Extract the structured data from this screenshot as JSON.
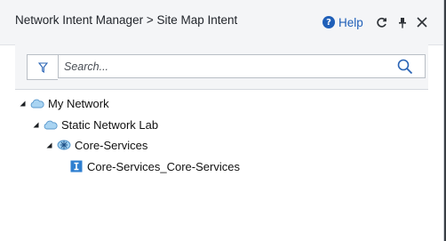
{
  "header": {
    "title": "Network Intent Manager  > Site Map Intent",
    "help_label": "Help",
    "help_icon": "question-circle-icon",
    "refresh_icon": "refresh-icon",
    "pin_icon": "pin-icon",
    "close_icon": "close-icon"
  },
  "search": {
    "placeholder": "Search...",
    "value": "",
    "filter_icon": "filter-icon",
    "search_icon": "magnifier-icon"
  },
  "tree": {
    "nodes": [
      {
        "label": "My Network",
        "icon": "cloud-icon",
        "expanded": true
      },
      {
        "label": "Static Network Lab",
        "icon": "cloud-icon",
        "expanded": true
      },
      {
        "label": "Core-Services",
        "icon": "site-star-icon",
        "expanded": true
      },
      {
        "label": "Core-Services_Core-Services",
        "icon": "intent-i-icon"
      }
    ]
  },
  "colors": {
    "accent": "#1f5fb8",
    "title_bar": "#f4f5f7",
    "border": "#b9bec5"
  }
}
